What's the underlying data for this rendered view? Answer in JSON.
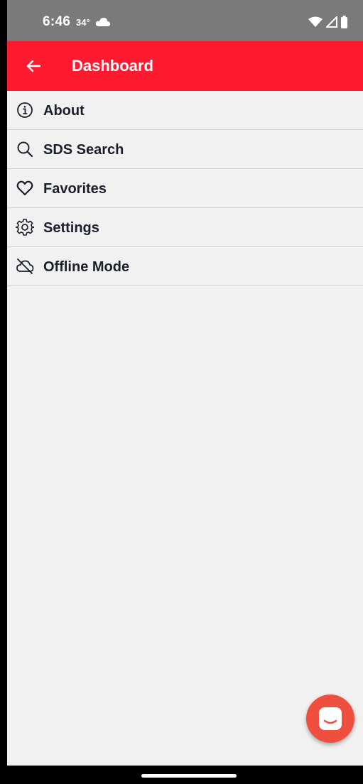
{
  "status_bar": {
    "time": "6:46",
    "temperature": "34°",
    "weather_icon": "cloud-icon",
    "system_icons": [
      "wifi-icon",
      "signal-icon",
      "battery-icon"
    ]
  },
  "app_bar": {
    "title": "Dashboard",
    "back_icon": "arrow-left-icon",
    "color": "#ff1a2f"
  },
  "menu": {
    "items": [
      {
        "label": "About",
        "icon": "info-icon"
      },
      {
        "label": "SDS Search",
        "icon": "search-icon"
      },
      {
        "label": "Favorites",
        "icon": "heart-icon"
      },
      {
        "label": "Settings",
        "icon": "gear-icon"
      },
      {
        "label": "Offline Mode",
        "icon": "cloud-off-icon"
      }
    ]
  },
  "fab": {
    "icon": "chat-icon",
    "color": "#ef4f3f"
  }
}
